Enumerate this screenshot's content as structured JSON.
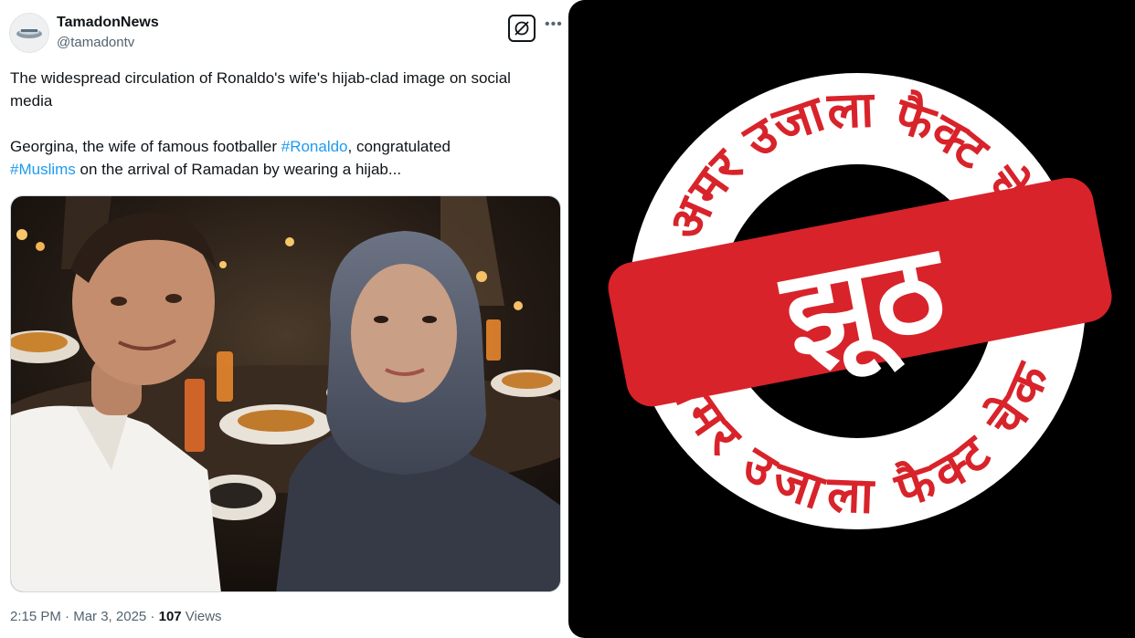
{
  "tweet": {
    "author_name": "TamadonNews",
    "handle": "@tamadontv",
    "paragraph1": "The widespread circulation of Ronaldo's wife's hijab-clad image on social media",
    "paragraph2": {
      "part1": "Georgina, the wife of famous footballer ",
      "hashtag1": "#Ronaldo",
      "part2": ", congratulated ",
      "hashtag2": "#Muslims",
      "part3": " on the arrival of Ramadan by wearing a hijab..."
    },
    "time": "2:15 PM",
    "separator": " · ",
    "date": "Mar 3, 2025",
    "views_count": "107",
    "views_label": " Views",
    "icons": {
      "grok": "grok-icon",
      "more": "more-options-icon"
    }
  },
  "fact_check": {
    "ring_text_top": "अमर उजाला फैक्ट चेक",
    "ring_text_bottom": "अमर उजाला फैक्ट चेक",
    "verdict": "झूठ",
    "colors": {
      "stamp_red": "#d8232a",
      "background": "#000000",
      "ring": "#ffffff"
    }
  },
  "colors": {
    "link": "#1d9bf0",
    "muted": "#536471",
    "text": "#0f1419"
  }
}
